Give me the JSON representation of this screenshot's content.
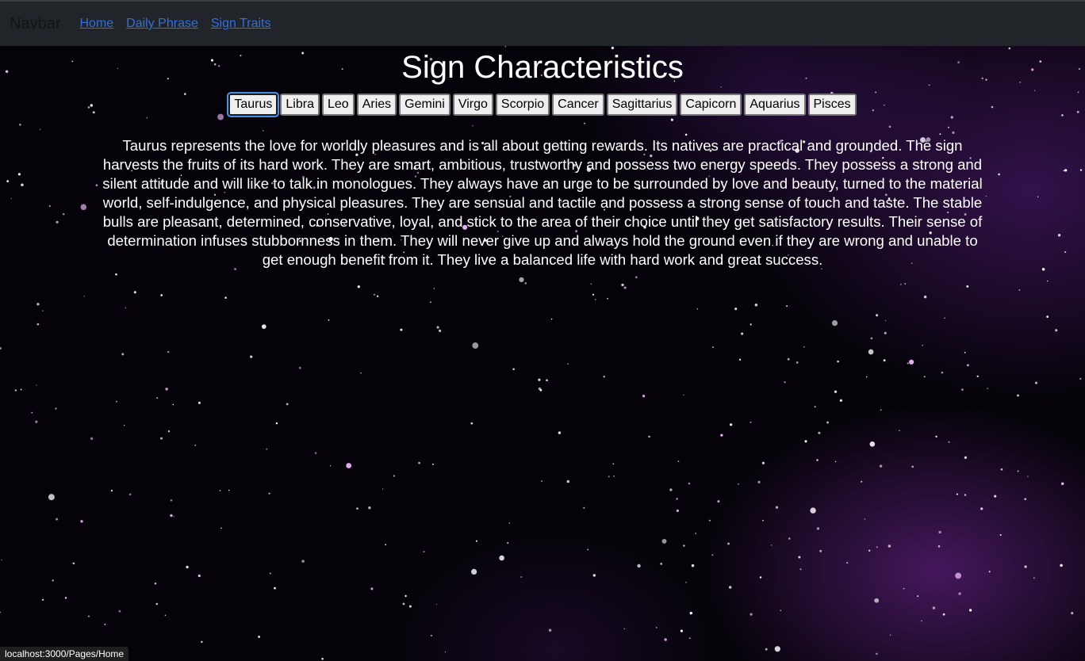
{
  "navbar": {
    "brand": "Navbar",
    "links": [
      "Home",
      "Daily Phrase",
      "Sign Traits"
    ]
  },
  "main": {
    "title": "Sign Characteristics",
    "signs": [
      "Taurus",
      "Libra",
      "Leo",
      "Aries",
      "Gemini",
      "Virgo",
      "Scorpio",
      "Cancer",
      "Sagittarius",
      "Capicorn",
      "Aquarius",
      "Pisces"
    ],
    "selected_sign": "Taurus",
    "description": "Taurus represents the love for worldly pleasures and is all about getting rewards. Its natives are practical and grounded. The sign harvests the fruits of its hard work. They are smart, ambitious, trustworthy and possess two energy speeds. They possess a strong and silent attitude and will like to talk in monologues. They always have an urge to be surrounded by love and beauty, turned to the material world, self-indulgence, and physical pleasures. They are sensual and tactile and possess a strong sense of touch and taste. The stable bulls are pleasant, determined, conservative, loyal, and stick to the area of their choice until they get satisfactory results. Their sense of determination infuses stubbornness in them. They will never give up and always hold the ground even if they are wrong and unable to get enough benefit from it. They live a balanced life with hard work and great success."
  },
  "status_bar": {
    "url": "localhost:3000/Pages/Home"
  },
  "colors": {
    "navbar_bg": "#212529",
    "link": "#2f6fe0",
    "text": "#ffffff",
    "background": "#050309"
  }
}
